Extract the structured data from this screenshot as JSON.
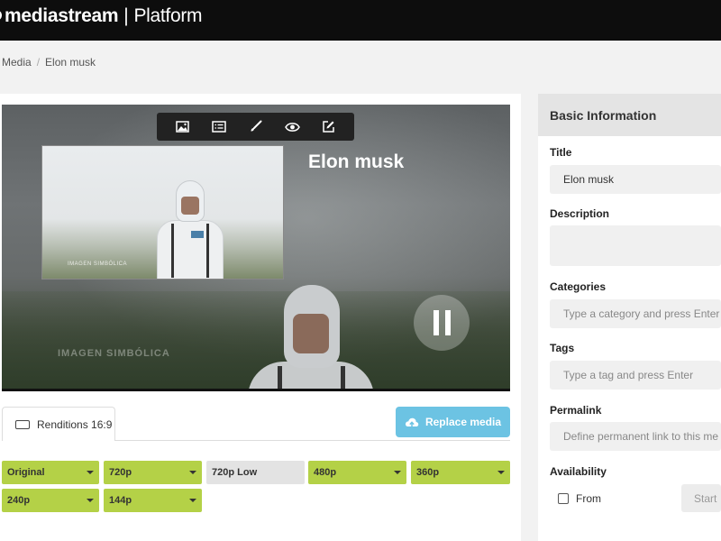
{
  "header": {
    "brand": "mediastream",
    "product": "Platform"
  },
  "breadcrumb": {
    "items": [
      "Media",
      "Elon musk"
    ]
  },
  "player": {
    "title": "Elon musk",
    "watermark": "IMAGEN SIMBÓLICA",
    "pip_watermark": "IMAGEN SIMBÓLICA",
    "toolbar_icons": [
      "image-icon",
      "list-icon",
      "brush-icon",
      "eye-icon",
      "edit-icon"
    ],
    "state": "playing"
  },
  "renditions": {
    "tab_label": "Renditions 16:9",
    "replace_label": "Replace media",
    "items": [
      {
        "label": "Original",
        "color": "#b4d147",
        "dropdown": true
      },
      {
        "label": "720p",
        "color": "#b4d147",
        "dropdown": true
      },
      {
        "label": "720p Low",
        "color": "#e3e3e3",
        "dropdown": false
      },
      {
        "label": "480p",
        "color": "#b4d147",
        "dropdown": true
      },
      {
        "label": "360p",
        "color": "#b4d147",
        "dropdown": true
      },
      {
        "label": "240p",
        "color": "#b4d147",
        "dropdown": true
      },
      {
        "label": "144p",
        "color": "#b4d147",
        "dropdown": true
      }
    ]
  },
  "basic_info": {
    "heading": "Basic Information",
    "title_label": "Title",
    "title_value": "Elon musk",
    "description_label": "Description",
    "description_value": "",
    "categories_label": "Categories",
    "categories_placeholder": "Type a category and press Enter",
    "tags_label": "Tags",
    "tags_placeholder": "Type a tag and press Enter",
    "permalink_label": "Permalink",
    "permalink_placeholder": "Define permanent link to this me",
    "availability_label": "Availability",
    "from_label": "From",
    "start_label": "Start"
  },
  "colors": {
    "accent_green": "#b4d147",
    "replace_blue": "#6cc3e3",
    "topbar": "#0d0d0d"
  }
}
